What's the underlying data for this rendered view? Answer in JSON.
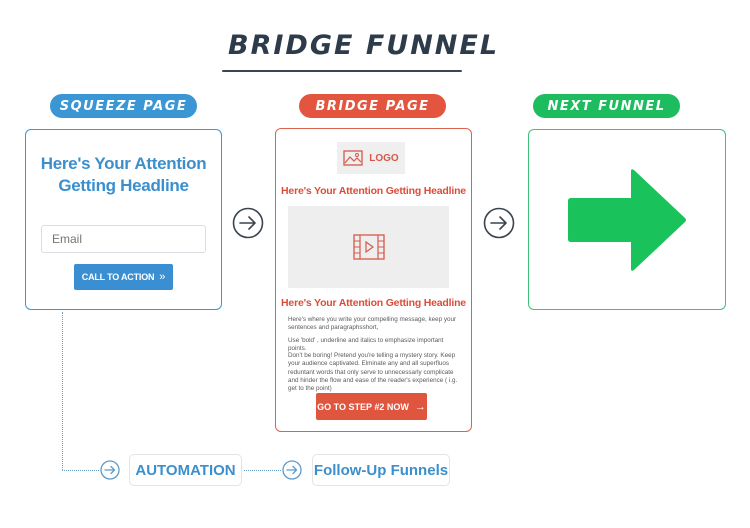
{
  "title": "BRIDGE FUNNEL",
  "stages": {
    "squeeze": {
      "label": "SQUEEZE PAGE",
      "headline": "Here's Your Attention Getting Headline",
      "email_placeholder": "Email",
      "cta_label": "CALL TO ACTION",
      "cta_icon": "»"
    },
    "bridge": {
      "label": "BRIDGE PAGE",
      "logo_label": "LOGO",
      "headline_top": "Here's Your Attention Getting Headline",
      "headline_bottom": "Here's Your Attention Getting Headline",
      "paragraph_1": "Here's where you write your compelling message, keep your sentences and paragraphsshort,",
      "paragraph_2": "Use 'bold' , underline and italics to emphasize important points.",
      "paragraph_3": "Don't be boring! Pretend you're telling a mystery story. Keep your audience captivated. Elminate any and all superfluos reduntant words that only serve to unnecessarly complicate and hinder the flow and ease of the reader's experience ( i.g. get to the point)",
      "button_label": "GO TO STEP #2 NOW",
      "button_icon": "→"
    },
    "next": {
      "label": "NEXT FUNNEL"
    }
  },
  "bottom_flow": {
    "automation_label": "AUTOMATION",
    "followup_label": "Follow-Up Funnels"
  },
  "colors": {
    "squeeze": "#3a96d5",
    "bridge": "#e3553f",
    "next": "#1dbd5f",
    "title": "#2d3b4a"
  }
}
